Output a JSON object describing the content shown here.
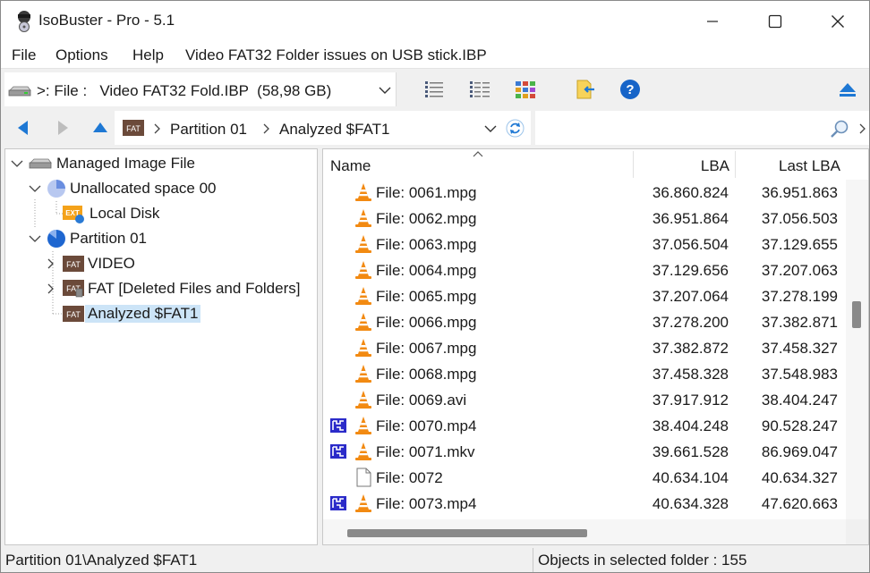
{
  "window": {
    "title": "IsoBuster - Pro - 5.1",
    "minimize_glyph": "—",
    "maximize_glyph": "☐",
    "close_glyph": "✕"
  },
  "menu": {
    "file": "File",
    "options": "Options",
    "help": "Help",
    "document": "Video FAT32 Folder issues on USB stick.IBP"
  },
  "toolbar": {
    "source_label": ">: File :   Video FAT32 Fold.IBP  (58,98 GB)",
    "icons": [
      "drive-icon",
      "list-view-icon",
      "detail-view-icon",
      "thumbnail-view-icon",
      "extract-folder-icon",
      "help-icon",
      "eject-icon"
    ]
  },
  "address": {
    "crumbs": [
      "Partition 01",
      "Analyzed $FAT1"
    ],
    "fat_badge": "FAT",
    "search_placeholder": ""
  },
  "tree": {
    "items": [
      {
        "label": "Managed Image File",
        "icon": "drive-icon"
      },
      {
        "label": "Unallocated space 00",
        "icon": "pie-partial-icon"
      },
      {
        "label": "Local Disk",
        "icon": "ext-volume-icon",
        "badge": "EXT"
      },
      {
        "label": "Partition 01",
        "icon": "pie-full-icon"
      },
      {
        "label": "VIDEO",
        "icon": "fat-folder-icon",
        "badge": "FAT"
      },
      {
        "label": "FAT [Deleted Files and Folders]",
        "icon": "fat-deleted-icon",
        "badge": "FAT"
      },
      {
        "label": "Analyzed $FAT1",
        "icon": "fat-folder-icon",
        "badge": "FAT"
      }
    ]
  },
  "list": {
    "columns": {
      "name": "Name",
      "lba": "LBA",
      "last_lba": "Last LBA"
    },
    "rows": [
      {
        "name": "File: 0061.mpg",
        "lba": "36.860.824",
        "last_lba": "36.951.863",
        "marked": false,
        "type": "video"
      },
      {
        "name": "File: 0062.mpg",
        "lba": "36.951.864",
        "last_lba": "37.056.503",
        "marked": false,
        "type": "video"
      },
      {
        "name": "File: 0063.mpg",
        "lba": "37.056.504",
        "last_lba": "37.129.655",
        "marked": false,
        "type": "video"
      },
      {
        "name": "File: 0064.mpg",
        "lba": "37.129.656",
        "last_lba": "37.207.063",
        "marked": false,
        "type": "video"
      },
      {
        "name": "File: 0065.mpg",
        "lba": "37.207.064",
        "last_lba": "37.278.199",
        "marked": false,
        "type": "video"
      },
      {
        "name": "File: 0066.mpg",
        "lba": "37.278.200",
        "last_lba": "37.382.871",
        "marked": false,
        "type": "video"
      },
      {
        "name": "File: 0067.mpg",
        "lba": "37.382.872",
        "last_lba": "37.458.327",
        "marked": false,
        "type": "video"
      },
      {
        "name": "File: 0068.mpg",
        "lba": "37.458.328",
        "last_lba": "37.548.983",
        "marked": false,
        "type": "video"
      },
      {
        "name": "File: 0069.avi",
        "lba": "37.917.912",
        "last_lba": "38.404.247",
        "marked": false,
        "type": "video"
      },
      {
        "name": "File: 0070.mp4",
        "lba": "38.404.248",
        "last_lba": "90.528.247",
        "marked": true,
        "type": "video"
      },
      {
        "name": "File: 0071.mkv",
        "lba": "39.661.528",
        "last_lba": "86.969.047",
        "marked": true,
        "type": "video"
      },
      {
        "name": "File: 0072",
        "lba": "40.634.104",
        "last_lba": "40.634.327",
        "marked": false,
        "type": "blank"
      },
      {
        "name": "File: 0073.mp4",
        "lba": "40.634.328",
        "last_lba": "47.620.663",
        "marked": true,
        "type": "video"
      }
    ]
  },
  "status": {
    "path": "Partition 01\\Analyzed $FAT1",
    "objects": "Objects in selected folder : 155"
  },
  "colors": {
    "selection": "#cce4f7",
    "nav_blue": "#1e78d4",
    "vlc_orange": "#f28a12",
    "fat_badge": "#6b4a3a",
    "marker_blue": "#2b2bc9"
  }
}
